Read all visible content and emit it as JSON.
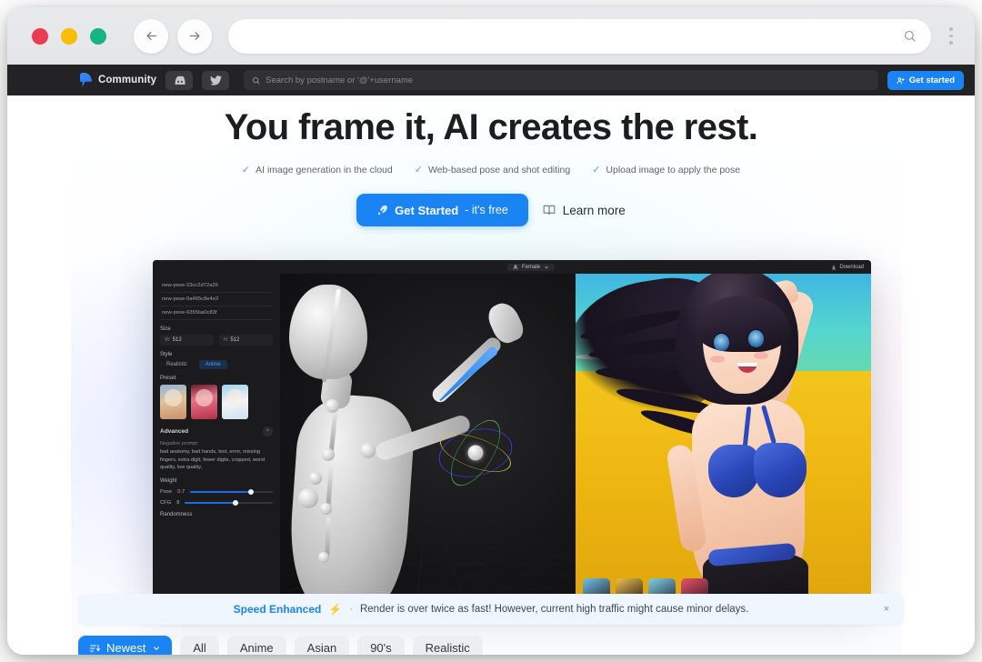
{
  "browser": {
    "traffic_lights": [
      "close",
      "minimize",
      "maximize"
    ],
    "back_icon": "arrow-left-icon",
    "forward_icon": "arrow-right-icon",
    "url_value": "",
    "url_placeholder": "",
    "url_search_icon": "search-icon",
    "menu_icon": "kebab-menu-icon",
    "colors": {
      "red": "#ED3B53",
      "yellow": "#FBBC05",
      "green": "#16B583"
    }
  },
  "site_header": {
    "brand_label": "Community",
    "brand_icon": "posemaniacs-logo-icon",
    "discord_icon": "discord-icon",
    "twitter_icon": "twitter-icon",
    "search_placeholder": "Search by postname or '@'+username",
    "search_value": "",
    "search_icon": "search-icon",
    "get_started_label": "Get started",
    "get_started_icon": "user-plus-icon",
    "accent": "#1A84F5"
  },
  "hero": {
    "headline": "You frame it, AI creates the rest.",
    "features": [
      {
        "check": "✓",
        "text": "AI image generation in the cloud"
      },
      {
        "check": "✓",
        "text": "Web-based pose and shot editing"
      },
      {
        "check": "✓",
        "text": "Upload image to apply the pose"
      }
    ],
    "cta_primary_icon": "rocket-icon",
    "cta_primary_strong": "Get Started",
    "cta_primary_light": "- it's free",
    "cta_secondary_icon": "book-open-icon",
    "cta_secondary_label": "Learn more"
  },
  "screenshot": {
    "topbar": {
      "gender_label": "Female",
      "gender_icon": "person-icon",
      "gender_chevron": "chevron-down-icon",
      "download_label": "Download",
      "download_icon": "download-icon"
    },
    "sidebar": {
      "poses": [
        "new-pose-23cc2d72a26",
        "new-pose-0a465c8e4e2",
        "new-pose-6355ba0c83f"
      ],
      "size_label": "Size",
      "size_w_key": "W",
      "size_w_value": "512",
      "size_h_key": "H",
      "size_h_value": "512",
      "style_label": "Style",
      "style_options": [
        "Realistic",
        "Anime"
      ],
      "style_selected": "Anime",
      "preset_label": "Preset",
      "advanced_label": "Advanced",
      "advanced_chevron": "chevron-up-icon",
      "negative_prompt_label": "Negative prompt",
      "negative_prompt_text": "bad anatomy, bad hands, text, error, missing fingers, extra digit, fewer digits, cropped, worst quality, low quality,",
      "weight_label": "Weight",
      "sliders": [
        {
          "label": "Pose",
          "value": "0.7",
          "fill_pct": 74
        },
        {
          "label": "CFG",
          "value": "8",
          "fill_pct": 58
        }
      ],
      "randomness_label": "Randomness"
    }
  },
  "toast": {
    "strong": "Speed Enhanced",
    "bolt_icon": "lightning-bolt-icon",
    "separator": "·",
    "message": "Render is over twice as fast! However, current high traffic might cause minor delays.",
    "close_label": "×",
    "background": "#EFF6FE",
    "accent": "#1A84F5"
  },
  "filters": {
    "sort_icon": "sort-descending-icon",
    "sort_label": "Newest",
    "sort_chevron": "chevron-down-icon",
    "chips": [
      "All",
      "Anime",
      "Asian",
      "90's",
      "Realistic"
    ]
  }
}
